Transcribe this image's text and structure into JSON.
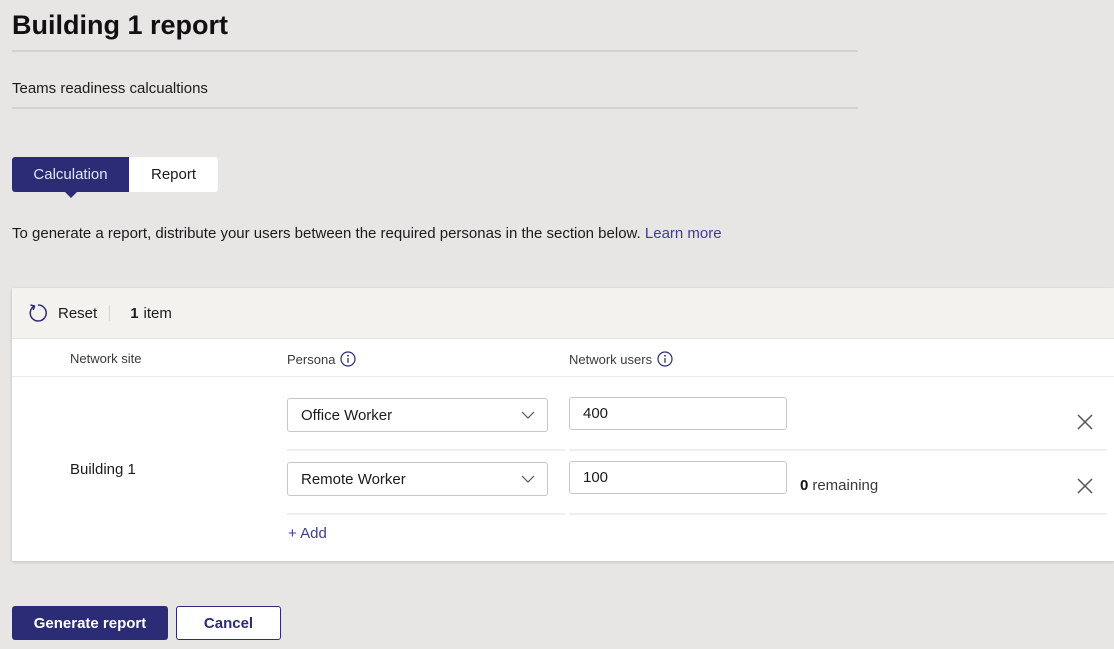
{
  "page": {
    "title": "Building 1 report",
    "subtitle": "Teams readiness calcualtions"
  },
  "tabs": [
    {
      "label": "Calculation",
      "active": true
    },
    {
      "label": "Report",
      "active": false
    }
  ],
  "instructions": {
    "text": "To generate a report, distribute your users between the required personas in the section below. ",
    "link_label": "Learn more"
  },
  "toolbar": {
    "reset_label": "Reset",
    "reset_icon": "refresh-icon",
    "item_count": "1",
    "item_label": "item"
  },
  "table": {
    "columns": [
      {
        "label": "Network site",
        "info_icon": false
      },
      {
        "label": "Persona",
        "info_icon": true
      },
      {
        "label": "Network users",
        "info_icon": true
      }
    ],
    "site": {
      "name": "Building 1",
      "rows": [
        {
          "persona": "Office Worker",
          "users": "400",
          "remove_icon": "close-icon"
        },
        {
          "persona": "Remote Worker",
          "users": "100",
          "remove_icon": "close-icon"
        }
      ],
      "remaining_count": "0",
      "remaining_label": "remaining",
      "add_label": "+ Add"
    }
  },
  "footer": {
    "primary_label": "Generate report",
    "secondary_label": "Cancel"
  },
  "colors": {
    "accent": "#2b2c75",
    "link": "#3c3e8f",
    "page_background": "#e8e6e4",
    "toolbar_background": "#f3f2ef"
  }
}
